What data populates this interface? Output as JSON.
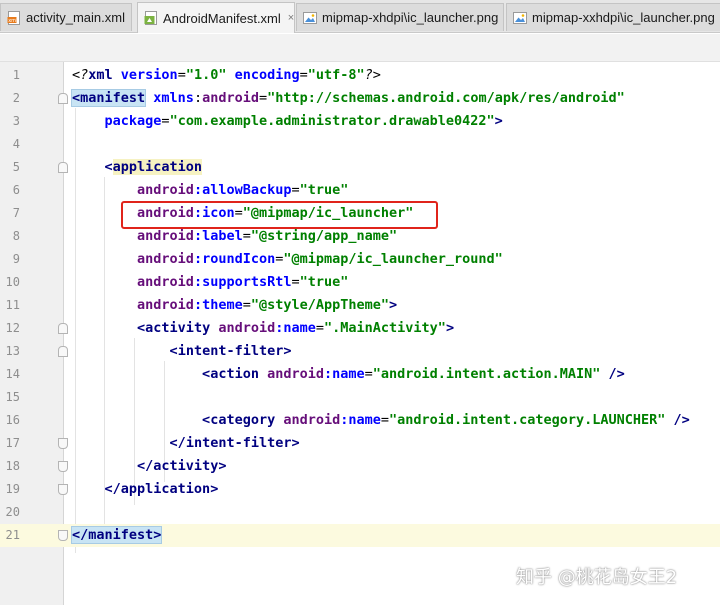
{
  "tabs": [
    {
      "label": "activity_main.xml",
      "icon": "xml-file-icon",
      "active": false
    },
    {
      "label": "AndroidManifest.xml",
      "icon": "manifest-file-icon",
      "active": true
    },
    {
      "label": "mipmap-xhdpi\\ic_launcher.png",
      "icon": "image-file-icon",
      "active": false
    },
    {
      "label": "mipmap-xxhdpi\\ic_launcher.png",
      "icon": "image-file-icon",
      "active": false
    }
  ],
  "close_glyph": "×",
  "editor": {
    "lines": [
      {
        "n": "1"
      },
      {
        "n": "2"
      },
      {
        "n": "3"
      },
      {
        "n": "4"
      },
      {
        "n": "5"
      },
      {
        "n": "6"
      },
      {
        "n": "7"
      },
      {
        "n": "8"
      },
      {
        "n": "9"
      },
      {
        "n": "10"
      },
      {
        "n": "11"
      },
      {
        "n": "12"
      },
      {
        "n": "13"
      },
      {
        "n": "14"
      },
      {
        "n": "15"
      },
      {
        "n": "16"
      },
      {
        "n": "17"
      },
      {
        "n": "18"
      },
      {
        "n": "19"
      },
      {
        "n": "20"
      },
      {
        "n": "21"
      }
    ],
    "current_line": "21",
    "tokens": {
      "l1_open": "<?",
      "l1_xml": "xml",
      "l1_version_attr": " version",
      "l1_eq1": "=",
      "l1_version_val": "\"1.0\"",
      "l1_encoding_attr": " encoding",
      "l1_eq2": "=",
      "l1_encoding_val": "\"utf-8\"",
      "l1_close": "?>",
      "l2_lt": "<",
      "l2_tag": "manifest",
      "l2_xmlns": " xmlns",
      "l2_colon": ":",
      "l2_android": "android",
      "l2_eq": "=",
      "l2_val": "\"http://schemas.android.com/apk/res/android\"",
      "l3_indent": "    ",
      "l3_attr": "package",
      "l3_eq": "=",
      "l3_val": "\"com.example.administrator.drawable0422\"",
      "l3_gt": ">",
      "l5_indent": "    ",
      "l5_lt": "<",
      "l5_tag": "application",
      "l6_indent": "        ",
      "l6_ns": "android",
      "l6_attr": ":allowBackup",
      "l6_eq": "=",
      "l6_val": "\"true\"",
      "l7_indent": "        ",
      "l7_ns": "android",
      "l7_attr": ":icon",
      "l7_eq": "=",
      "l7_val": "\"@mipmap/ic_launcher\"",
      "l8_indent": "        ",
      "l8_ns": "android",
      "l8_attr": ":label",
      "l8_eq": "=",
      "l8_val": "\"@string/app_name\"",
      "l9_indent": "        ",
      "l9_ns": "android",
      "l9_attr": ":roundIcon",
      "l9_eq": "=",
      "l9_val": "\"@mipmap/ic_launcher_round\"",
      "l10_indent": "        ",
      "l10_ns": "android",
      "l10_attr": ":supportsRtl",
      "l10_eq": "=",
      "l10_val": "\"true\"",
      "l11_indent": "        ",
      "l11_ns": "android",
      "l11_attr": ":theme",
      "l11_eq": "=",
      "l11_val": "\"@style/AppTheme\"",
      "l11_gt": ">",
      "l12_indent": "        ",
      "l12_lt": "<",
      "l12_tag": "activity",
      "l12_ns": " android",
      "l12_attr": ":name",
      "l12_eq": "=",
      "l12_val": "\".MainActivity\"",
      "l12_gt": ">",
      "l13_indent": "            ",
      "l13_lt": "<",
      "l13_tag": "intent-filter",
      "l13_gt": ">",
      "l14_indent": "                ",
      "l14_lt": "<",
      "l14_tag": "action",
      "l14_ns": " android",
      "l14_attr": ":name",
      "l14_eq": "=",
      "l14_val": "\"android.intent.action.MAIN\"",
      "l14_end": " />",
      "l16_indent": "                ",
      "l16_lt": "<",
      "l16_tag": "category",
      "l16_ns": " android",
      "l16_attr": ":name",
      "l16_eq": "=",
      "l16_val": "\"android.intent.category.LAUNCHER\"",
      "l16_end": " />",
      "l17_indent": "            ",
      "l17_lt": "</",
      "l17_tag": "intent-filter",
      "l17_gt": ">",
      "l18_indent": "        ",
      "l18_lt": "</",
      "l18_tag": "activity",
      "l18_gt": ">",
      "l19_indent": "    ",
      "l19_lt": "</",
      "l19_tag": "application",
      "l19_gt": ">",
      "l21_lt": "</",
      "l21_tag": "manifest",
      "l21_gt": ">"
    }
  },
  "annotation": {
    "color": "#e0241b",
    "target_line": "7"
  },
  "watermark": "知乎 @桃花岛女王2"
}
